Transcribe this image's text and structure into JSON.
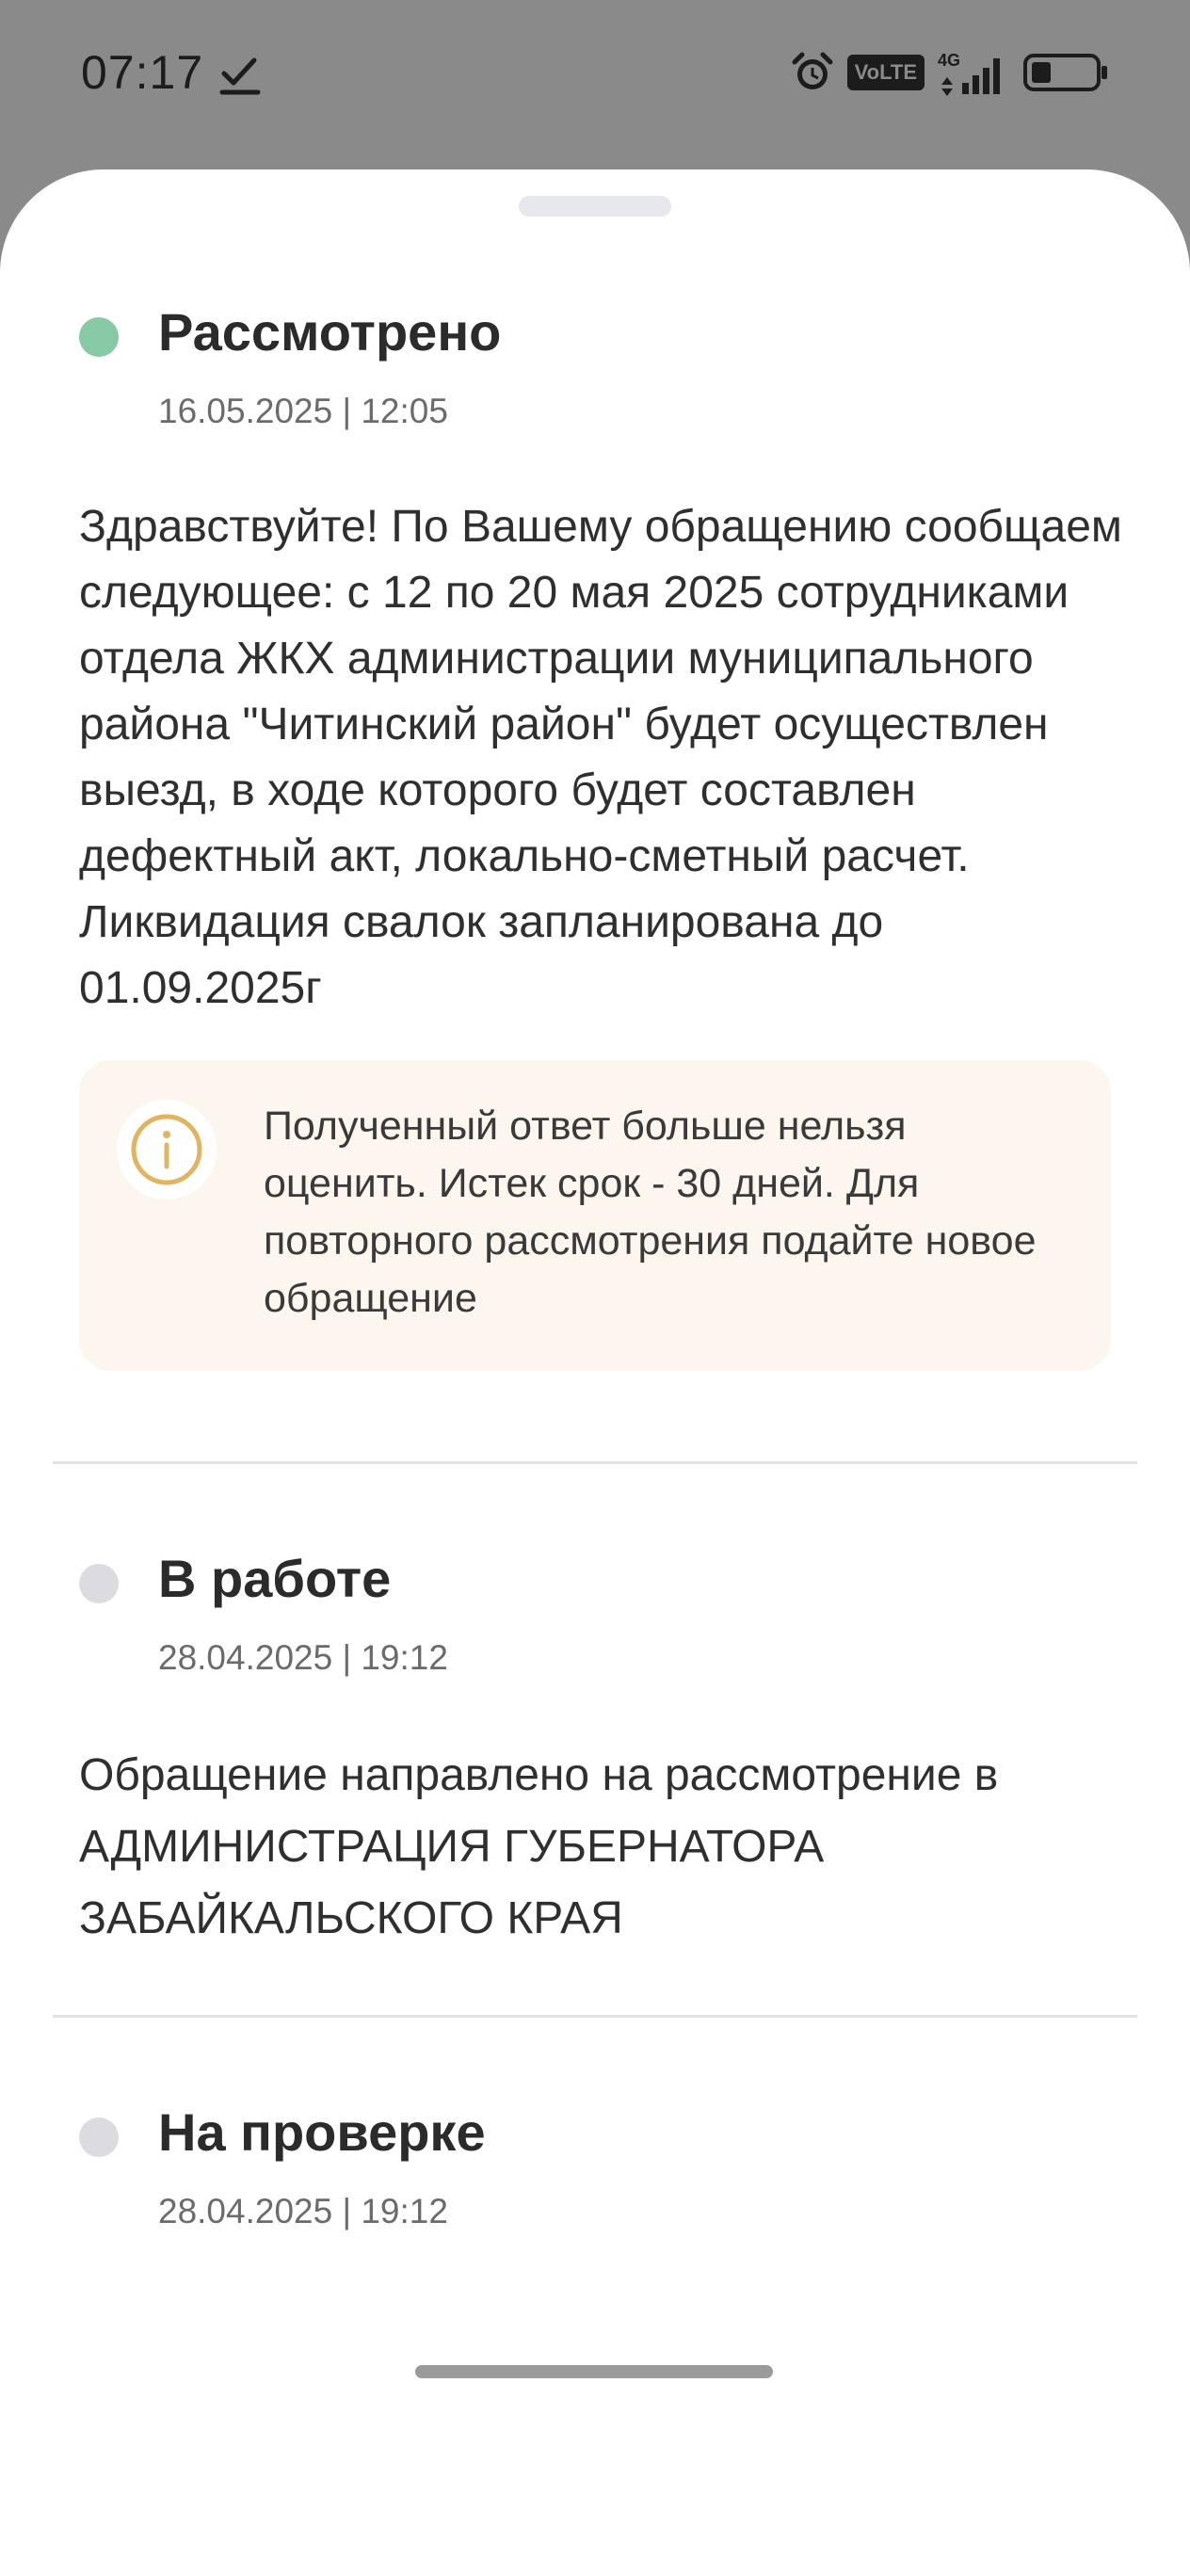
{
  "status_bar": {
    "time": "07:17",
    "volte": "VoLTE",
    "network": "4G"
  },
  "statuses": [
    {
      "title": "Рассмотрено",
      "date": "16.05.2025 | 12:05",
      "message": "Здравствуйте! По Вашему обращению сообщаем следующее: с 12 по 20 мая 2025 сотрудниками отдела ЖКХ администрации муниципального района \"Читинский район\" будет осуществлен выезд, в ходе которого будет составлен дефектный акт, локально-сметный расчет. Ликвидация свалок запланирована до 01.09.2025г",
      "dot_color": "#86c9a3"
    },
    {
      "title": "В работе",
      "date": "28.04.2025 | 19:12",
      "message": "Обращение направлено на рассмотрение в АДМИНИСТРАЦИЯ ГУБЕРНАТОРА ЗАБАЙКАЛЬСКОГО КРАЯ",
      "dot_color": "#dcdbe0"
    },
    {
      "title": "На проверке",
      "date": "28.04.2025 | 19:12",
      "dot_color": "#dcdbe0"
    }
  ],
  "notice": {
    "text": "Полученный ответ больше нельзя оценить. Истек срок - 30 дней. Для повторного рассмотрения подайте новое обращение",
    "icon": "info-icon",
    "accent_color": "#e0b461",
    "background": "#fdf6ee"
  }
}
